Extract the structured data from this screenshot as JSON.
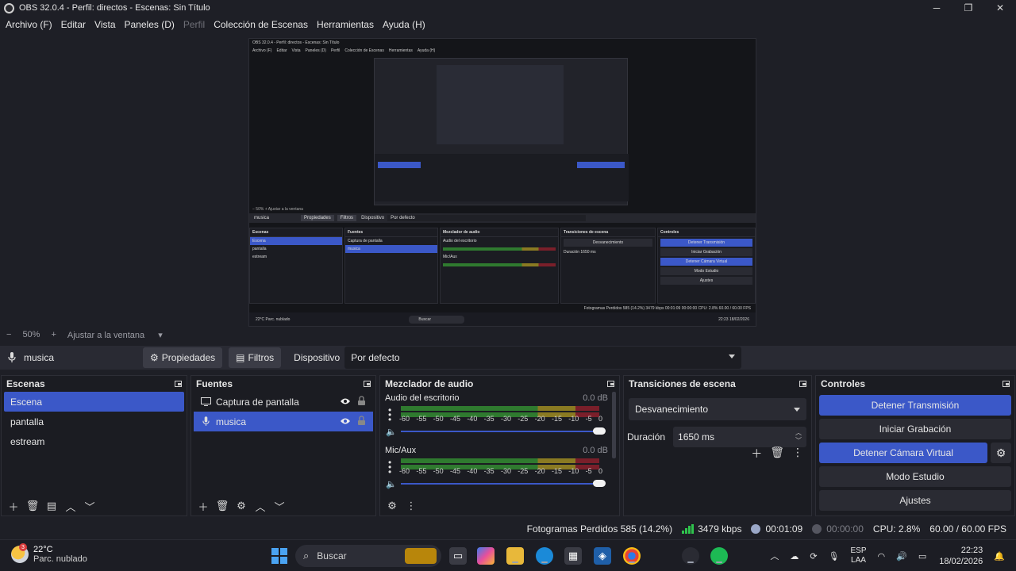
{
  "window": {
    "title": "OBS 32.0.4 - Perfil: directos - Escenas: Sin Título",
    "minimize": "─",
    "maximize": "❐",
    "close": "✕"
  },
  "menu": [
    {
      "label": "Archivo (F)",
      "enabled": true
    },
    {
      "label": "Editar",
      "enabled": true
    },
    {
      "label": "Vista",
      "enabled": true
    },
    {
      "label": "Paneles (D)",
      "enabled": true
    },
    {
      "label": "Perfil",
      "enabled": false
    },
    {
      "label": "Colección de Escenas",
      "enabled": true
    },
    {
      "label": "Herramientas",
      "enabled": true
    },
    {
      "label": "Ayuda (H)",
      "enabled": true
    }
  ],
  "zoom": {
    "minus": "−",
    "value": "50%",
    "plus": "+",
    "fit_label": "Ajustar a la ventana"
  },
  "source_toolbar": {
    "source_name": "musica",
    "properties_label": "Propiedades",
    "filters_label": "Filtros",
    "device_label": "Dispositivo",
    "device_value": "Por defecto"
  },
  "scenes": {
    "title": "Escenas",
    "items": [
      "Escena",
      "pantalla",
      "estream"
    ],
    "selected_index": 0
  },
  "sources": {
    "title": "Fuentes",
    "items": [
      {
        "name": "Captura de pantalla",
        "icon": "monitor-icon",
        "selected": false
      },
      {
        "name": "musica",
        "icon": "microphone-icon",
        "selected": true
      }
    ]
  },
  "mixer": {
    "title": "Mezclador de audio",
    "channels": [
      {
        "name": "Audio del escritorio",
        "db": "0.0 dB",
        "volume": 1.0
      },
      {
        "name": "Mic/Aux",
        "db": "0.0 dB",
        "volume": 1.0
      }
    ],
    "ticks": [
      "-60",
      "-55",
      "-50",
      "-45",
      "-40",
      "-35",
      "-30",
      "-25",
      "-20",
      "-15",
      "-10",
      "-5",
      "0"
    ]
  },
  "transitions": {
    "title": "Transiciones de escena",
    "selected": "Desvanecimiento",
    "duration_label": "Duración",
    "duration_value": "1650 ms"
  },
  "controls": {
    "title": "Controles",
    "stop_stream": "Detener Transmisión",
    "start_recording": "Iniciar Grabación",
    "stop_virtual_cam": "Detener Cámara Virtual",
    "studio_mode": "Modo Estudio",
    "settings": "Ajustes"
  },
  "status": {
    "dropped_frames": "Fotogramas Perdidos 585 (14.2%)",
    "bitrate": "3479 kbps",
    "stream_time": "00:01:09",
    "record_time": "00:00:00",
    "cpu": "CPU: 2.8%",
    "fps": "60.00 / 60.00 FPS"
  },
  "taskbar": {
    "weather_temp": "22°C",
    "weather_desc": "Parc. nublado",
    "weather_badge": "3",
    "search_label": "Buscar",
    "lang_top": "ESP",
    "lang_bottom": "LAA",
    "time": "22:23",
    "date": "18/02/2026"
  },
  "mini_preview": {
    "title": "OBS 32.0.4 - Perfil: directos - Escenas: Sin Título",
    "menu": [
      "Archivo (F)",
      "Editar",
      "Vista",
      "Paneles (D)",
      "Perfil",
      "Colección de Escenas",
      "Herramientas",
      "Ayuda (H)"
    ],
    "zoom_text": "− 50% + Ajustar a la ventana",
    "source_name": "musica",
    "properties": "Propiedades",
    "filters": "Filtros",
    "device": "Dispositivo",
    "device_value": "Por defecto",
    "scenes_title": "Escenas",
    "scenes": [
      "Escena",
      "pantalla",
      "estream"
    ],
    "sources_title": "Fuentes",
    "sources": [
      "Captura de pantalla",
      "musica"
    ],
    "mixer_title": "Mezclador de audio",
    "mixer_ch1": "Audio del escritorio",
    "mixer_ch2": "Mic/Aux",
    "mixer_db": "0.0 dB",
    "trans_title": "Transiciones de escena",
    "trans_selected": "Desvanecimiento",
    "trans_duration_label": "Duración",
    "trans_duration": "1650 ms",
    "controls_title": "Controles",
    "controls": [
      "Detener Transmisión",
      "Iniciar Grabación",
      "Detener Cámara Virtual",
      "Modo Estudio",
      "Ajustes"
    ],
    "status": "Fotogramas Perdidos 585 (14.2%)   3479 kbps   00:01:09   00:00:00   CPU: 2.8%   60.00 / 60.00 FPS",
    "weather": "22°C Parc. nublado",
    "search": "Buscar",
    "clock": "22:23 18/02/2026"
  },
  "colors": {
    "accent": "#3b58c8",
    "background": "#1e1f26",
    "panel": "#1b1c22",
    "meter_green": "#2f7a2f",
    "meter_yellow": "#8a7a22",
    "meter_red": "#7a1f2a",
    "bitrate_green": "#2fc44d"
  }
}
